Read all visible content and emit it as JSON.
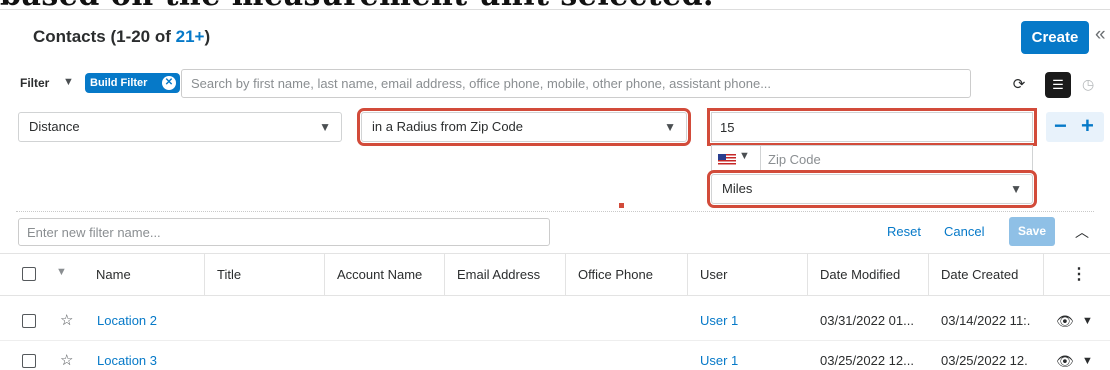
{
  "heading_text": "based on the measurement unit selected.",
  "header": {
    "title_prefix": "Contacts (1-20 of ",
    "title_count": "21+",
    "title_suffix": ")",
    "create_label": "Create",
    "collapse_glyph": "«"
  },
  "filter_bar": {
    "filter_label": "Filter",
    "build_filter_label": "Build Filter",
    "search_placeholder": "Search by first name, last name, email address, office phone, mobile, other phone, assistant phone..."
  },
  "filter_row": {
    "field_select": "Distance",
    "operator_select": "in a Radius from Zip Code",
    "value_input": "15",
    "zip_placeholder": "Zip Code",
    "unit_select": "Miles"
  },
  "filter_actions": {
    "name_placeholder": "Enter new filter name...",
    "reset_label": "Reset",
    "cancel_label": "Cancel",
    "save_label": "Save"
  },
  "colors": {
    "accent": "#0679c8",
    "highlight_outline": "#d24b3a"
  },
  "table": {
    "columns": [
      "Name",
      "Title",
      "Account Name",
      "Email Address",
      "Office Phone",
      "User",
      "Date Modified",
      "Date Created"
    ],
    "rows": [
      {
        "name": "Location 2",
        "title": "",
        "account": "",
        "email": "",
        "phone": "",
        "user": "User 1",
        "modified": "03/31/2022 01...",
        "created": "03/14/2022 11:."
      },
      {
        "name": "Location 3",
        "title": "",
        "account": "",
        "email": "",
        "phone": "",
        "user": "User 1",
        "modified": "03/25/2022 12...",
        "created": "03/25/2022 12."
      }
    ]
  }
}
